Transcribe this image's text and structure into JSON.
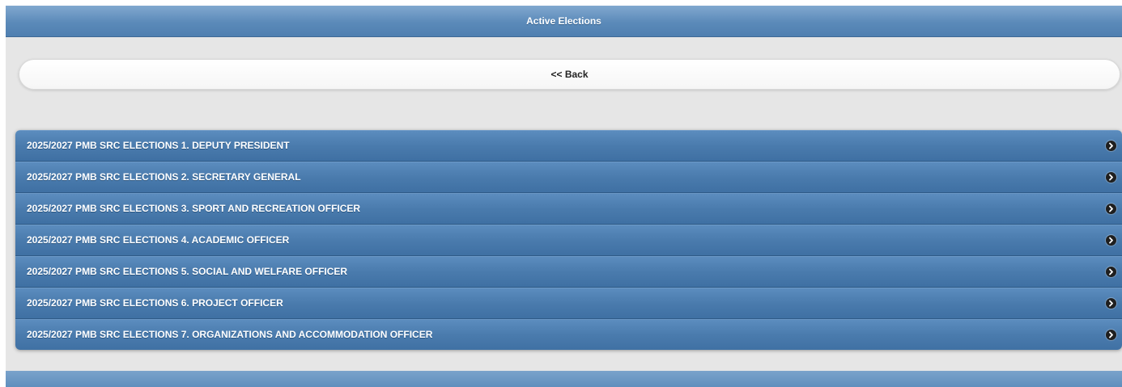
{
  "header": {
    "title": "Active Elections"
  },
  "back_button": {
    "label": "<< Back"
  },
  "elections": [
    {
      "label": "2025/2027 PMB SRC ELECTIONS 1. DEPUTY PRESIDENT",
      "icon": "chevron-right-circle-icon"
    },
    {
      "label": "2025/2027 PMB SRC ELECTIONS 2. SECRETARY GENERAL",
      "icon": "chevron-right-circle-icon"
    },
    {
      "label": "2025/2027 PMB SRC ELECTIONS 3. SPORT AND RECREATION OFFICER",
      "icon": "chevron-right-circle-icon"
    },
    {
      "label": "2025/2027 PMB SRC ELECTIONS 4. ACADEMIC OFFICER",
      "icon": "chevron-right-circle-icon"
    },
    {
      "label": "2025/2027 PMB SRC ELECTIONS 5. SOCIAL AND WELFARE OFFICER",
      "icon": "chevron-right-circle-icon"
    },
    {
      "label": "2025/2027 PMB SRC ELECTIONS 6. PROJECT OFFICER",
      "icon": "chevron-right-circle-icon"
    },
    {
      "label": "2025/2027 PMB SRC ELECTIONS 7. ORGANIZATIONS AND ACCOMMODATION OFFICER",
      "icon": "chevron-right-circle-icon"
    }
  ],
  "colors": {
    "header_bar": "#5b8ab9",
    "list_item": "#4a7bad",
    "background": "#e6e6e6"
  }
}
